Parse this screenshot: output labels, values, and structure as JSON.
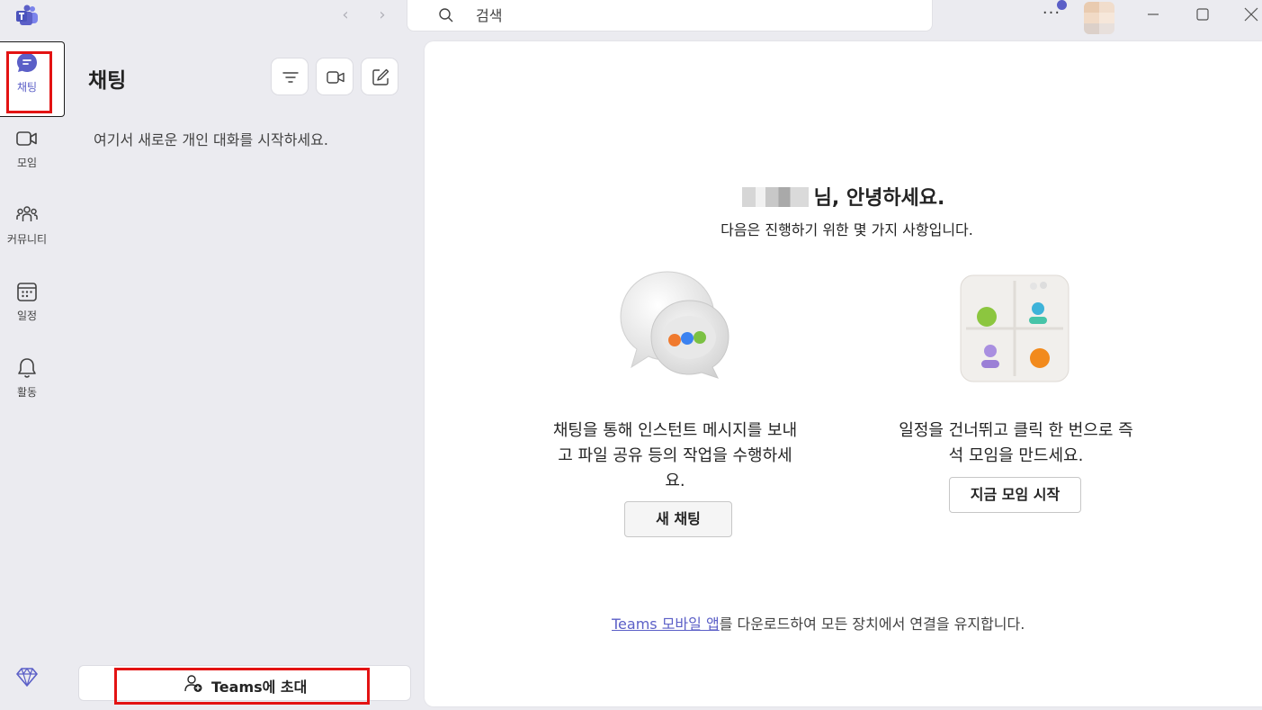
{
  "titlebar": {
    "search_placeholder": "검색",
    "more_label": "···"
  },
  "rail": {
    "items": [
      {
        "label": "채팅",
        "icon": "chat-icon",
        "active": true
      },
      {
        "label": "모임",
        "icon": "video-icon"
      },
      {
        "label": "커뮤니티",
        "icon": "community-icon"
      },
      {
        "label": "일정",
        "icon": "calendar-icon"
      },
      {
        "label": "활동",
        "icon": "bell-icon"
      }
    ],
    "premium_icon": "diamond-icon"
  },
  "chat_pane": {
    "title": "채팅",
    "empty_text": "여기서 새로운 개인 대화를 시작하세요.",
    "invite_label": "Teams에 초대"
  },
  "main": {
    "greeting_suffix": "님, 안녕하세요.",
    "subtitle": "다음은 진행하기 위한 몇 가지 사항입니다.",
    "cards": [
      {
        "description": "채팅을 통해 인스턴트 메시지를 보내\n고 파일 공유 등의 작업을 수행하세\n요.",
        "button": "새 채팅"
      },
      {
        "description": "일정을 건너뛰고 클릭 한 번으로 즉\n석 모임을 만드세요.",
        "button": "지금 모임 시작"
      }
    ],
    "footer_link": "Teams 모바일 앱",
    "footer_text": "를 다운로드하여 모든 장치에서 연결을 유지합니다."
  },
  "colors": {
    "accent": "#5b5fc7",
    "highlight": "#e31313",
    "background": "#ebebf0"
  }
}
